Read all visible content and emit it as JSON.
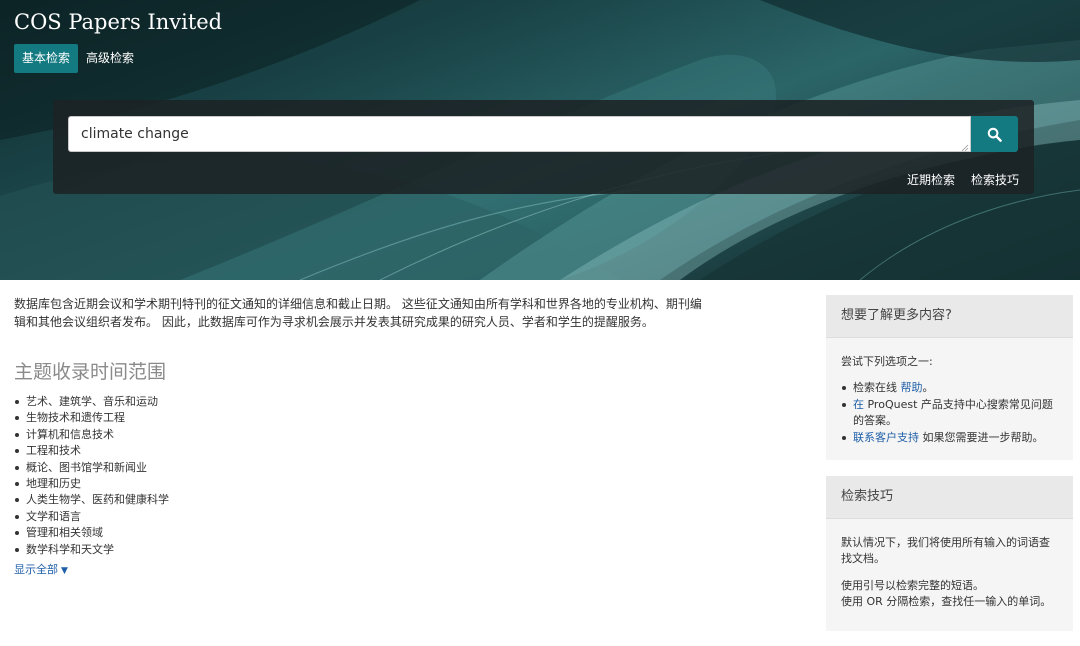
{
  "header": {
    "app_title": "COS Papers Invited",
    "tabs": [
      {
        "label": "基本检索",
        "active": true
      },
      {
        "label": "高级检索",
        "active": false
      }
    ]
  },
  "search": {
    "value": "climate change",
    "button_icon": "search-icon",
    "links": [
      "近期检索",
      "检索技巧"
    ]
  },
  "main": {
    "intro_line1": "数据库包含近期会议和学术期刊特刊的征文通知的详细信息和截止日期。 这些征文通知由所有学科和世界各地的专业机构、期刊编",
    "intro_line2": "辑和其他会议组织者发布。 因此，此数据库可作为寻求机会展示并发表其研究成果的研究人员、学者和学生的提醒服务。",
    "section_heading": "主题收录时间范围",
    "subjects": [
      "艺术、建筑学、音乐和运动",
      "生物技术和遗传工程",
      "计算机和信息技术",
      "工程和技术",
      "概论、图书馆学和新闻业",
      "地理和历史",
      "人类生物学、医药和健康科学",
      "文学和语言",
      "管理和相关领域",
      "数学科学和天文学"
    ],
    "show_all": "显示全部",
    "show_all_icon": "caret-down-icon"
  },
  "sidebar": {
    "more": {
      "title": "想要了解更多内容?",
      "intro": "尝试下列选项之一:",
      "item1_prefix": "检索在线 ",
      "item1_link": "帮助",
      "item1_suffix": "。",
      "item2_link": "在",
      "item2_text_a": " ProQuest 产品支持中心搜索常见问题",
      "item2_text_b": "的答案。",
      "item3_link": "联系客户支持",
      "item3_suffix": " 如果您需要进一步帮助。"
    },
    "tips": {
      "title": "检索技巧",
      "p1_line1": "默认情况下，我们将使用所有输入的词语查",
      "p1_line2": "找文档。",
      "p2_line1": "使用引号以检索完整的短语。",
      "p2_line2": "使用 OR 分隔检索，查找任一输入的单词。"
    }
  },
  "colors": {
    "accent": "#127a80",
    "link": "#1f5fa8",
    "heading_gray": "#8a8a8a"
  }
}
